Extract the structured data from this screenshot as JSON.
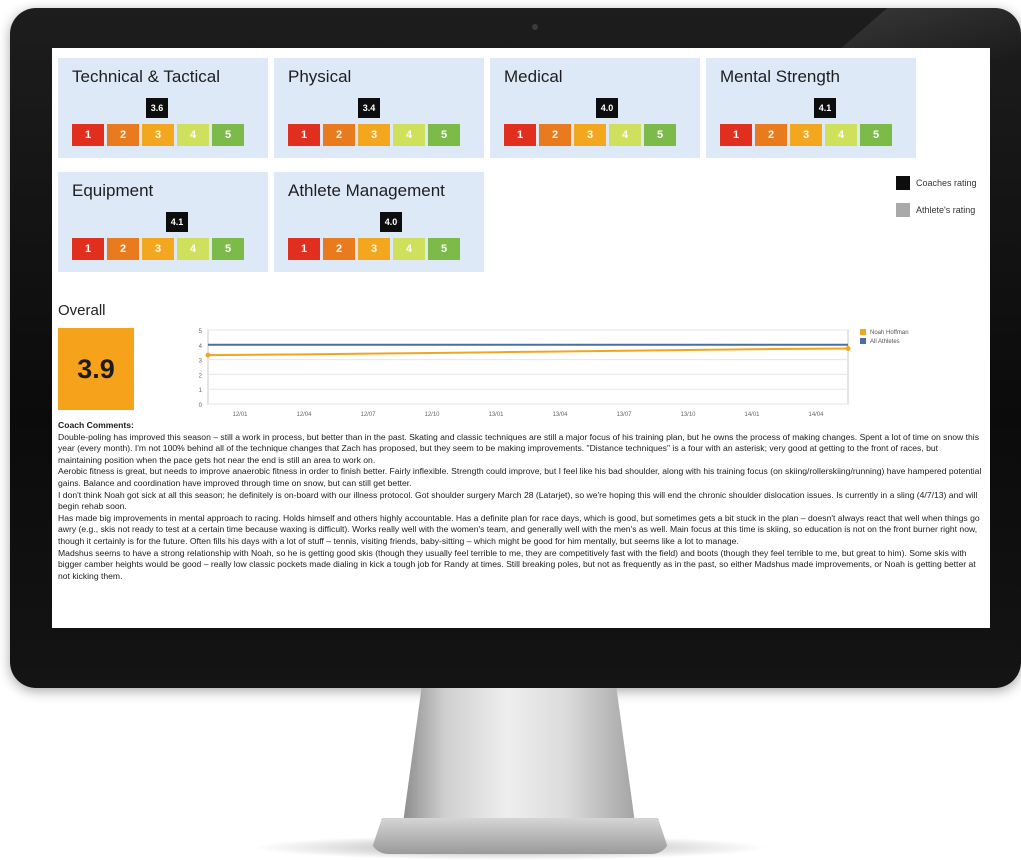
{
  "cards": [
    {
      "title": "Technical & Tactical",
      "rating": "3.6"
    },
    {
      "title": "Physical",
      "rating": "3.4"
    },
    {
      "title": "Medical",
      "rating": "4.0"
    },
    {
      "title": "Mental Strength",
      "rating": "4.1"
    },
    {
      "title": "Equipment",
      "rating": "4.1"
    },
    {
      "title": "Athlete Management",
      "rating": "4.0"
    }
  ],
  "scale_labels": [
    "1",
    "2",
    "3",
    "4",
    "5"
  ],
  "legend": {
    "coaches": "Coaches rating",
    "athletes": "Athlete's rating"
  },
  "colors": {
    "scale": [
      "#e02f1f",
      "#ea7a1e",
      "#f2a71f",
      "#cfe05d",
      "#7cba4a"
    ],
    "card_bg": "#dde9f6",
    "overall": "#f7a21b",
    "series_noah": "#f2a51f",
    "series_all": "#4a6fa5"
  },
  "overall": {
    "title": "Overall",
    "value": "3.9"
  },
  "chart_data": {
    "type": "line",
    "x": [
      "12/01",
      "12/04",
      "12/07",
      "12/10",
      "13/01",
      "13/04",
      "13/07",
      "13/10",
      "14/01",
      "14/04"
    ],
    "ylim": [
      0,
      5
    ],
    "yticks": [
      "0",
      "1",
      "2",
      "3",
      "4",
      "5"
    ],
    "series": [
      {
        "name": "Noah Hoffman",
        "values": [
          3.3,
          3.35,
          3.4,
          3.45,
          3.5,
          3.55,
          3.6,
          3.65,
          3.7,
          3.75
        ]
      },
      {
        "name": "All Athletes",
        "values": [
          4.0,
          4.0,
          4.0,
          4.0,
          4.0,
          4.0,
          4.0,
          4.0,
          4.0,
          4.0
        ]
      }
    ]
  },
  "comments": {
    "title": "Coach Comments:",
    "paragraphs": [
      "Double-poling has improved this season – still a work in process, but better than in the past. Skating and classic techniques are still a major focus of his training plan, but he owns the process of making changes. Spent a lot of time on snow this year (every month). I'm not 100% behind all of the technique changes that Zach has proposed, but they seem to be making improvements. \"Distance techniques\" is a four with an asterisk; very good at getting to the front of races, but maintaining position when the pace gets hot near the end is still an area to work on.",
      "Aerobic fitness is great, but needs to improve anaerobic fitness in order to finish better. Fairly inflexible. Strength could improve, but I feel like his bad shoulder, along with his training focus (on skiing/rollerskiing/running) have hampered potential gains. Balance and coordination have improved through time on snow, but can still get better.",
      "I don't think Noah got sick at all this season; he definitely is on-board with our illness protocol. Got shoulder surgery March 28 (Latarjet), so we're hoping this will end the chronic shoulder dislocation issues. Is currently in a sling (4/7/13) and will begin rehab soon.",
      "Has made big improvements in mental approach to racing. Holds himself and others highly accountable. Has a definite plan for race days, which is good, but sometimes gets a bit stuck in the plan – doesn't always react that well when things go awry (e.g., skis not ready to test at a certain time because waxing is difficult). Works really well with the women's team, and generally well with the men's as well. Main focus at this time is skiing, so education is not on the front burner right now, though it certainly is for the future. Often fills his days with a lot of stuff – tennis, visiting friends, baby-sitting – which might be good for him mentally, but seems like a lot to manage.",
      "Madshus seems to have a strong relationship with Noah, so he is getting good skis (though they usually feel terrible to me, they are competitively fast with the field) and boots (though they feel terrible to me, but great to him). Some skis with bigger camber heights would be good – really low classic pockets made dialing in kick a tough job for Randy at times. Still breaking poles, but not as frequently as in the past, so either Madshus made improvements, or Noah is getting better at not kicking them."
    ]
  }
}
